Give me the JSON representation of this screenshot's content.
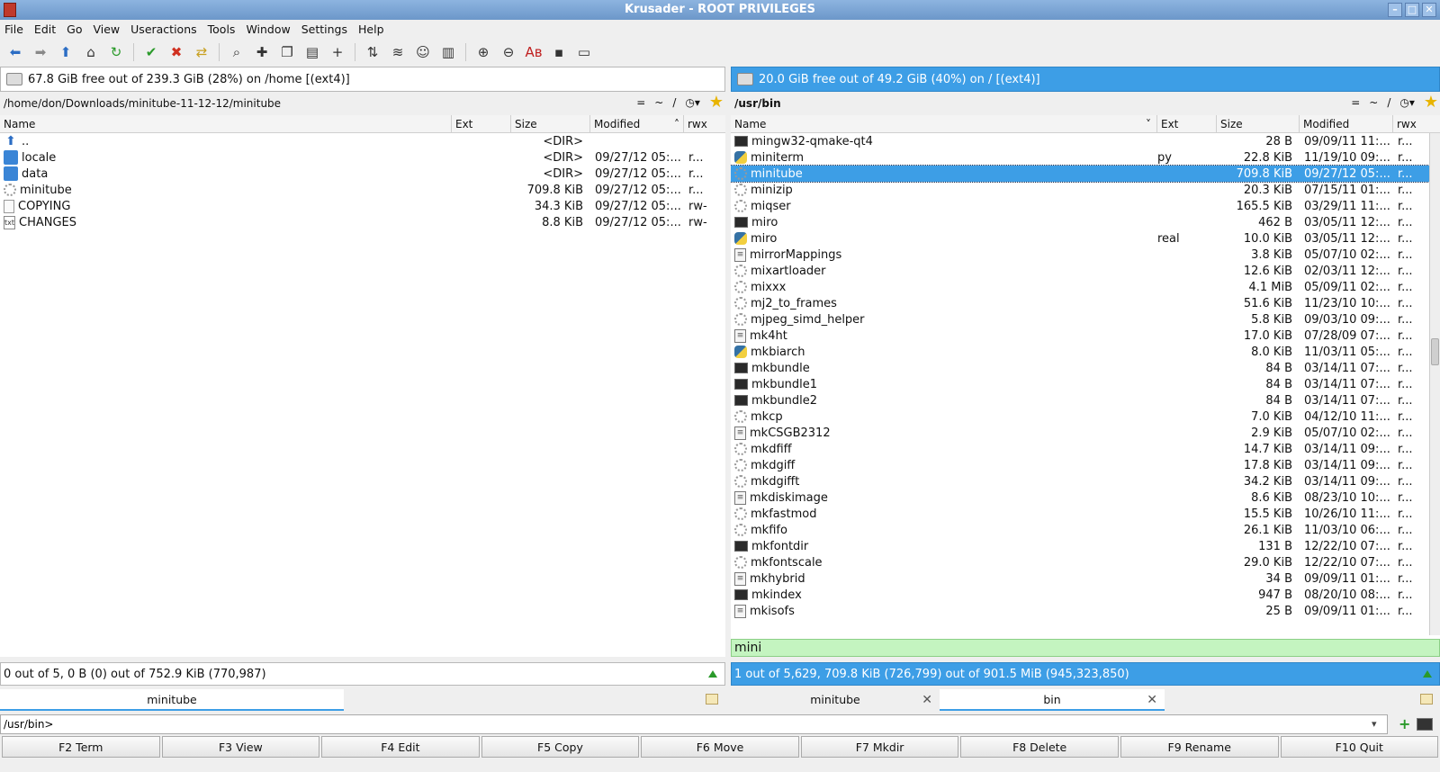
{
  "window": {
    "title": "Krusader - ROOT PRIVILEGES"
  },
  "menu": [
    "File",
    "Edit",
    "Go",
    "View",
    "Useractions",
    "Tools",
    "Window",
    "Settings",
    "Help"
  ],
  "toolbar": [
    "back-icon",
    "forward-icon",
    "up-icon",
    "home-icon",
    "refresh-icon",
    "sep",
    "select-all-icon",
    "unselect-all-icon",
    "invert-selection-icon",
    "sep",
    "search-icon",
    "new-file-icon",
    "copy-icon",
    "paste-icon",
    "add-icon",
    "sep",
    "network-icon",
    "compare-icon",
    "user-icon",
    "clipboard-icon",
    "sep",
    "zoom-in-icon",
    "zoom-out-icon",
    "spell-icon",
    "terminal-icon",
    "folder-tree-icon"
  ],
  "left": {
    "freespace": "67.8 GiB free out of 239.3 GiB (28%) on /home [(ext4)]",
    "path": "/home/don/Downloads/minitube-11-12-12/minitube",
    "tools": {
      "eq": "=",
      "tilde": "~",
      "slash": "/"
    },
    "columns": {
      "name": "Name",
      "ext": "Ext",
      "size": "Size",
      "modified": "Modified",
      "rwx": "rwx"
    },
    "rows": [
      {
        "icon": "up",
        "name": "..",
        "ext": "",
        "size": "<DIR>",
        "modified": "",
        "rwx": ""
      },
      {
        "icon": "dir",
        "name": "locale",
        "ext": "",
        "size": "<DIR>",
        "modified": "09/27/12 05:...",
        "rwx": "r..."
      },
      {
        "icon": "dir",
        "name": "data",
        "ext": "",
        "size": "<DIR>",
        "modified": "09/27/12 05:...",
        "rwx": "r..."
      },
      {
        "icon": "exe",
        "name": "minitube",
        "ext": "",
        "size": "709.8 KiB",
        "modified": "09/27/12 05:...",
        "rwx": "r..."
      },
      {
        "icon": "doc",
        "name": "COPYING",
        "ext": "",
        "size": "34.3 KiB",
        "modified": "09/27/12 05:...",
        "rwx": "rw-"
      },
      {
        "icon": "txt",
        "name": "CHANGES",
        "ext": "",
        "size": "8.8 KiB",
        "modified": "09/27/12 05:...",
        "rwx": "rw-"
      }
    ],
    "status": "0 out of 5, 0 B (0) out of 752.9 KiB (770,987)",
    "tabs": [
      "minitube"
    ]
  },
  "right": {
    "freespace": "20.0 GiB free out of 49.2 GiB (40%) on / [(ext4)]",
    "path": "/usr/bin",
    "tools": {
      "eq": "=",
      "tilde": "~",
      "slash": "/"
    },
    "columns": {
      "name": "Name",
      "ext": "Ext",
      "size": "Size",
      "modified": "Modified",
      "rwx": "rwx"
    },
    "rows": [
      {
        "icon": "term",
        "name": "mingw32-qmake-qt4",
        "ext": "",
        "size": "28 B",
        "modified": "09/09/11 11:...",
        "rwx": "r..."
      },
      {
        "icon": "py",
        "name": "miniterm",
        "ext": "py",
        "size": "22.8 KiB",
        "modified": "11/19/10 09:...",
        "rwx": "r..."
      },
      {
        "icon": "exe",
        "name": "minitube",
        "ext": "",
        "size": "709.8 KiB",
        "modified": "09/27/12 05:...",
        "rwx": "r...",
        "selected": true
      },
      {
        "icon": "exe",
        "name": "minizip",
        "ext": "",
        "size": "20.3 KiB",
        "modified": "07/15/11 01:...",
        "rwx": "r..."
      },
      {
        "icon": "exe",
        "name": "miqser",
        "ext": "",
        "size": "165.5 KiB",
        "modified": "03/29/11 11:...",
        "rwx": "r..."
      },
      {
        "icon": "term",
        "name": "miro",
        "ext": "",
        "size": "462 B",
        "modified": "03/05/11 12:...",
        "rwx": "r..."
      },
      {
        "icon": "py",
        "name": "miro",
        "ext": "real",
        "size": "10.0 KiB",
        "modified": "03/05/11 12:...",
        "rwx": "r..."
      },
      {
        "icon": "script",
        "name": "mirrorMappings",
        "ext": "",
        "size": "3.8 KiB",
        "modified": "05/07/10 02:...",
        "rwx": "r..."
      },
      {
        "icon": "exe",
        "name": "mixartloader",
        "ext": "",
        "size": "12.6 KiB",
        "modified": "02/03/11 12:...",
        "rwx": "r..."
      },
      {
        "icon": "exe",
        "name": "mixxx",
        "ext": "",
        "size": "4.1 MiB",
        "modified": "05/09/11 02:...",
        "rwx": "r..."
      },
      {
        "icon": "exe",
        "name": "mj2_to_frames",
        "ext": "",
        "size": "51.6 KiB",
        "modified": "11/23/10 10:...",
        "rwx": "r..."
      },
      {
        "icon": "exe",
        "name": "mjpeg_simd_helper",
        "ext": "",
        "size": "5.8 KiB",
        "modified": "09/03/10 09:...",
        "rwx": "r..."
      },
      {
        "icon": "script",
        "name": "mk4ht",
        "ext": "",
        "size": "17.0 KiB",
        "modified": "07/28/09 07:...",
        "rwx": "r..."
      },
      {
        "icon": "py",
        "name": "mkbiarch",
        "ext": "",
        "size": "8.0 KiB",
        "modified": "11/03/11 05:...",
        "rwx": "r..."
      },
      {
        "icon": "term",
        "name": "mkbundle",
        "ext": "",
        "size": "84 B",
        "modified": "03/14/11 07:...",
        "rwx": "r..."
      },
      {
        "icon": "term",
        "name": "mkbundle1",
        "ext": "",
        "size": "84 B",
        "modified": "03/14/11 07:...",
        "rwx": "r..."
      },
      {
        "icon": "term",
        "name": "mkbundle2",
        "ext": "",
        "size": "84 B",
        "modified": "03/14/11 07:...",
        "rwx": "r..."
      },
      {
        "icon": "exe",
        "name": "mkcp",
        "ext": "",
        "size": "7.0 KiB",
        "modified": "04/12/10 11:...",
        "rwx": "r..."
      },
      {
        "icon": "script",
        "name": "mkCSGB2312",
        "ext": "",
        "size": "2.9 KiB",
        "modified": "05/07/10 02:...",
        "rwx": "r..."
      },
      {
        "icon": "exe",
        "name": "mkdfiff",
        "ext": "",
        "size": "14.7 KiB",
        "modified": "03/14/11 09:...",
        "rwx": "r..."
      },
      {
        "icon": "exe",
        "name": "mkdgiff",
        "ext": "",
        "size": "17.8 KiB",
        "modified": "03/14/11 09:...",
        "rwx": "r..."
      },
      {
        "icon": "exe",
        "name": "mkdgifft",
        "ext": "",
        "size": "34.2 KiB",
        "modified": "03/14/11 09:...",
        "rwx": "r..."
      },
      {
        "icon": "script",
        "name": "mkdiskimage",
        "ext": "",
        "size": "8.6 KiB",
        "modified": "08/23/10 10:...",
        "rwx": "r..."
      },
      {
        "icon": "exe",
        "name": "mkfastmod",
        "ext": "",
        "size": "15.5 KiB",
        "modified": "10/26/10 11:...",
        "rwx": "r..."
      },
      {
        "icon": "exe",
        "name": "mkfifo",
        "ext": "",
        "size": "26.1 KiB",
        "modified": "11/03/10 06:...",
        "rwx": "r..."
      },
      {
        "icon": "term",
        "name": "mkfontdir",
        "ext": "",
        "size": "131 B",
        "modified": "12/22/10 07:...",
        "rwx": "r..."
      },
      {
        "icon": "exe",
        "name": "mkfontscale",
        "ext": "",
        "size": "29.0 KiB",
        "modified": "12/22/10 07:...",
        "rwx": "r..."
      },
      {
        "icon": "script",
        "name": "mkhybrid",
        "ext": "",
        "size": "34 B",
        "modified": "09/09/11 01:...",
        "rwx": "r..."
      },
      {
        "icon": "term",
        "name": "mkindex",
        "ext": "",
        "size": "947 B",
        "modified": "08/20/10 08:...",
        "rwx": "r..."
      },
      {
        "icon": "script",
        "name": "mkisofs",
        "ext": "",
        "size": "25 B",
        "modified": "09/09/11 01:...",
        "rwx": "r..."
      }
    ],
    "quicksearch": "mini",
    "status": "1 out of 5,629, 709.8 KiB (726,799) out of 901.5 MiB (945,323,850)",
    "tabs": [
      "minitube",
      "bin"
    ]
  },
  "cmdline": {
    "value": "/usr/bin>"
  },
  "fkeys": [
    "F2 Term",
    "F3 View",
    "F4 Edit",
    "F5 Copy",
    "F6 Move",
    "F7 Mkdir",
    "F8 Delete",
    "F9 Rename",
    "F10 Quit"
  ],
  "colors": {
    "accent": "#3d9ee6",
    "quicksearch": "#c4f4c0"
  }
}
